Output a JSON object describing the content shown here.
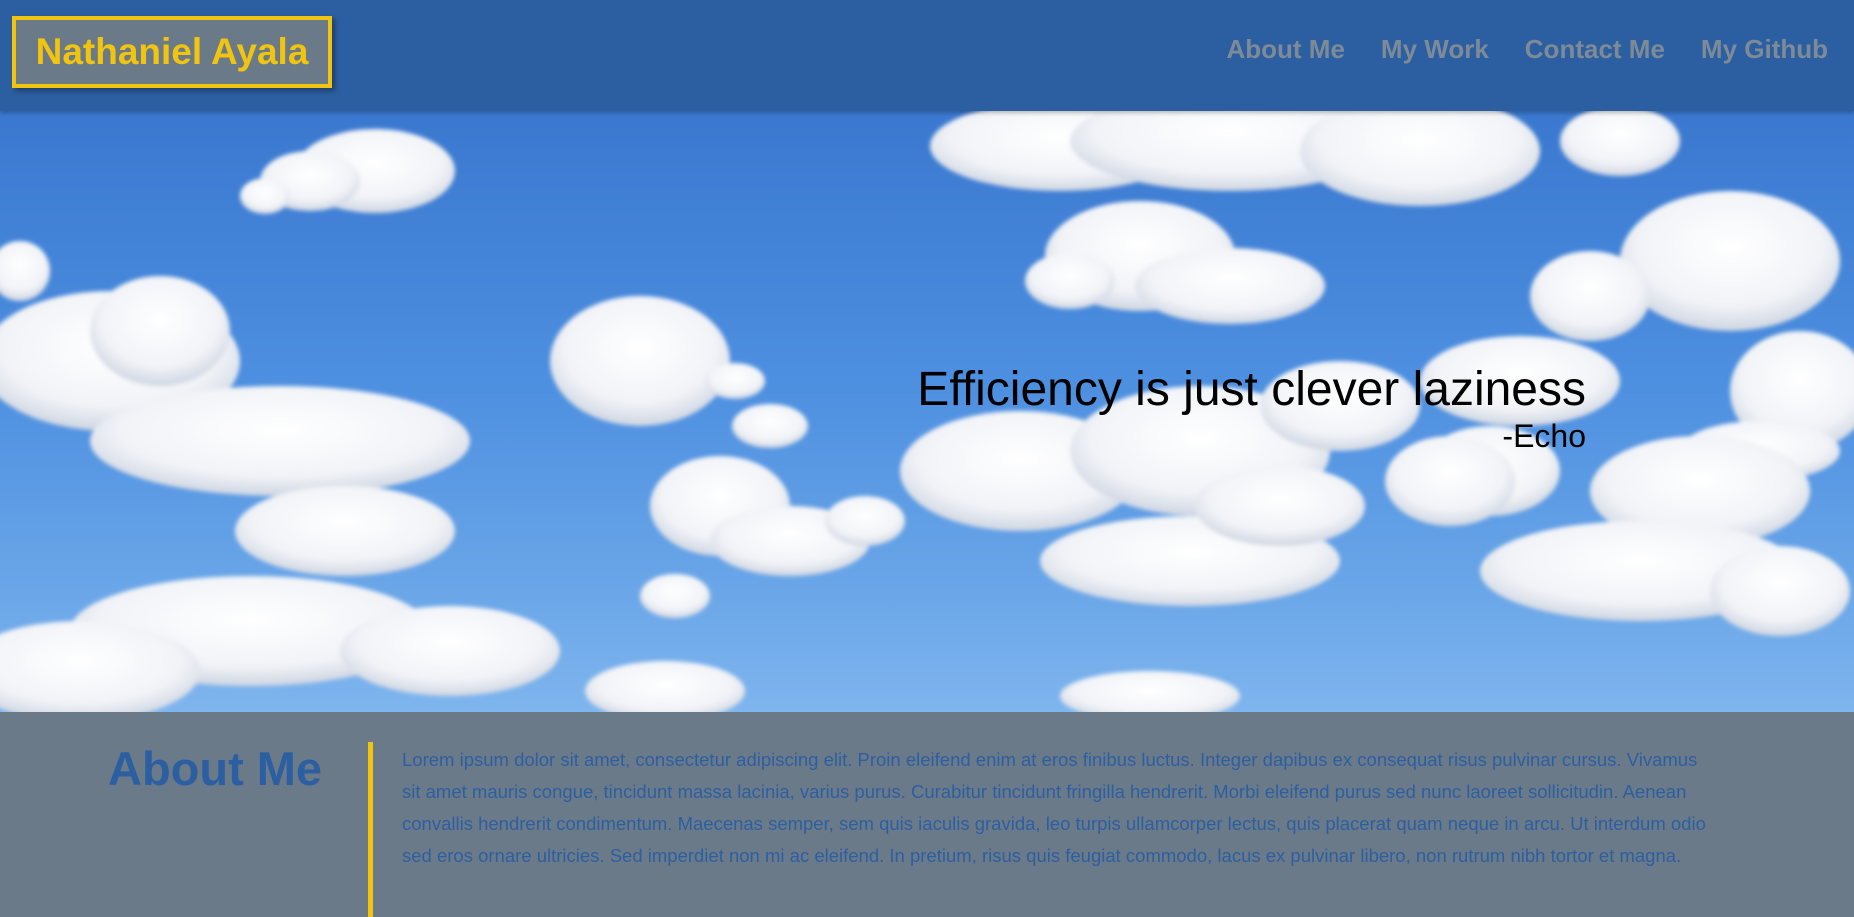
{
  "header": {
    "brand": "Nathaniel Ayala",
    "nav": [
      "About Me",
      "My Work",
      "Contact Me",
      "My Github"
    ]
  },
  "hero": {
    "quote": "Efficiency is just clever laziness",
    "author": "-Echo",
    "background": "sky-with-clouds"
  },
  "about": {
    "title": "About Me",
    "body": "Lorem ipsum dolor sit amet, consectetur adipiscing elit. Proin eleifend enim at eros finibus luctus. Integer dapibus ex consequat risus pulvinar cursus. Vivamus sit amet mauris congue, tincidunt massa lacinia, varius purus. Curabitur tincidunt fringilla hendrerit. Morbi eleifend purus sed nunc laoreet sollicitudin. Aenean convallis hendrerit condimentum. Maecenas semper, sem quis iaculis gravida, leo turpis ullamcorper lectus, quis placerat quam neque in arcu. Ut interdum odio sed eros ornare ultricies. Sed imperdiet non mi ac eleifend. In pretium, risus quis feugiat commodo, lacus ex pulvinar libero, non rutrum nibh tortor et magna."
  },
  "colors": {
    "header": "#2c5fa2",
    "accent": "#f1c40f",
    "panel": "#6b7a88",
    "nav_text": "#7e8b97"
  }
}
